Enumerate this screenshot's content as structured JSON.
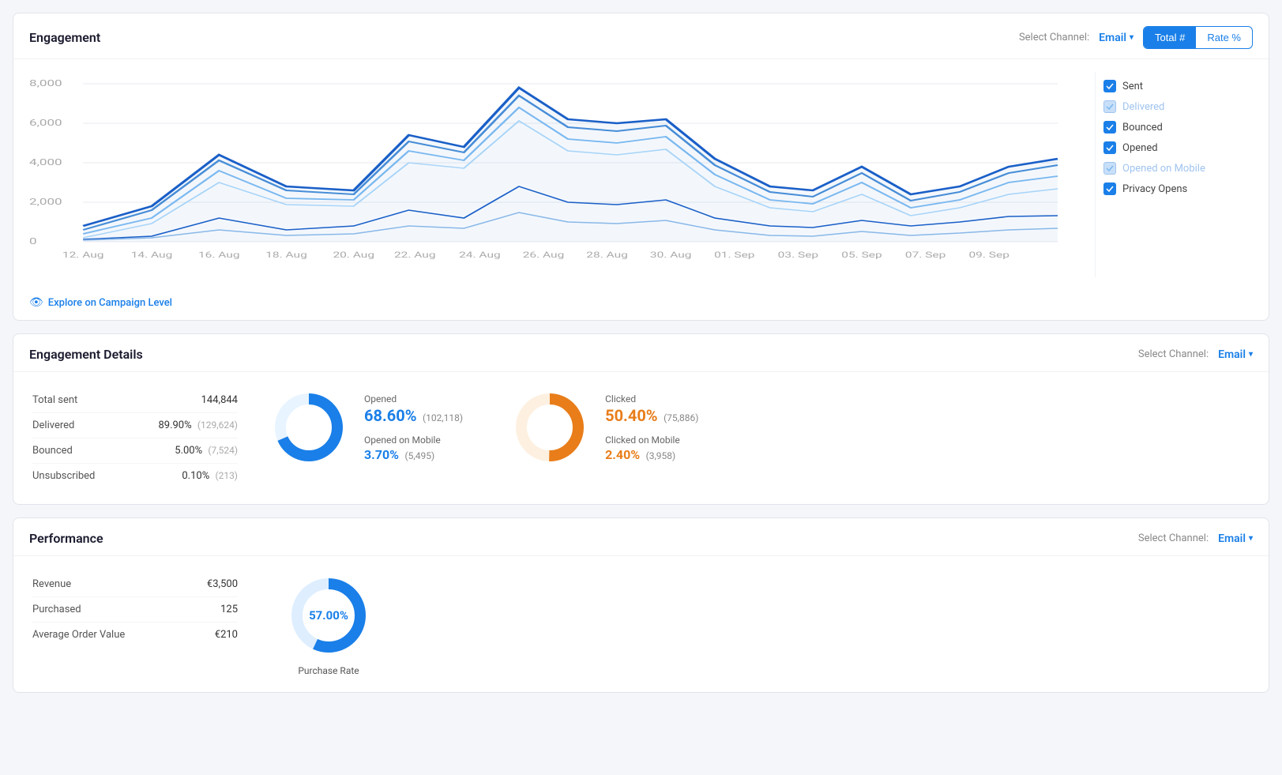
{
  "engagement": {
    "title": "Engagement",
    "select_channel_label": "Select Channel:",
    "channel": "Email",
    "toggle_total": "Total #",
    "toggle_rate": "Rate %",
    "active_toggle": "total",
    "explore_link": "Explore on Campaign Level",
    "legend": [
      {
        "id": "sent",
        "label": "Sent",
        "checked": true,
        "style": "solid"
      },
      {
        "id": "delivered",
        "label": "Delivered",
        "checked": true,
        "style": "light"
      },
      {
        "id": "bounced",
        "label": "Bounced",
        "checked": true,
        "style": "solid"
      },
      {
        "id": "opened",
        "label": "Opened",
        "checked": true,
        "style": "solid"
      },
      {
        "id": "opened_mobile",
        "label": "Opened on Mobile",
        "checked": true,
        "style": "light"
      },
      {
        "id": "privacy_opens",
        "label": "Privacy Opens",
        "checked": true,
        "style": "solid"
      }
    ],
    "chart": {
      "y_labels": [
        "8,000",
        "6,000",
        "4,000",
        "2,000",
        "0"
      ],
      "x_labels": [
        "12. Aug",
        "14. Aug",
        "16. Aug",
        "18. Aug",
        "20. Aug",
        "22. Aug",
        "24. Aug",
        "26. Aug",
        "28. Aug",
        "30. Aug",
        "01. Sep",
        "03. Sep",
        "05. Sep",
        "07. Sep",
        "09. Sep"
      ]
    }
  },
  "engagement_details": {
    "title": "Engagement Details",
    "select_channel_label": "Select Channel:",
    "channel": "Email",
    "stats": [
      {
        "label": "Total sent",
        "value": "144,844",
        "sub": ""
      },
      {
        "label": "Delivered",
        "value": "89.90%",
        "sub": "(129,624)"
      },
      {
        "label": "Bounced",
        "value": "5.00%",
        "sub": "(7,524)"
      },
      {
        "label": "Unsubscribed",
        "value": "0.10%",
        "sub": "(213)"
      }
    ],
    "opened": {
      "label": "Opened",
      "value": "68.60%",
      "sub": "(102,118)",
      "mobile_label": "Opened on Mobile",
      "mobile_value": "3.70%",
      "mobile_sub": "(5,495)",
      "donut_main_pct": 68.6,
      "donut_mobile_pct": 3.7
    },
    "clicked": {
      "label": "Clicked",
      "value": "50.40%",
      "sub": "(75,886)",
      "mobile_label": "Clicked on Mobile",
      "mobile_value": "2.40%",
      "mobile_sub": "(3,958)",
      "donut_main_pct": 50.4,
      "donut_mobile_pct": 2.4
    }
  },
  "performance": {
    "title": "Performance",
    "select_channel_label": "Select Channel:",
    "channel": "Email",
    "stats": [
      {
        "label": "Revenue",
        "value": "€3,500"
      },
      {
        "label": "Purchased",
        "value": "125"
      },
      {
        "label": "Average Order Value",
        "value": "€210"
      }
    ],
    "purchase_rate": {
      "label": "Purchase Rate",
      "value": "57.00%",
      "pct": 57
    }
  }
}
